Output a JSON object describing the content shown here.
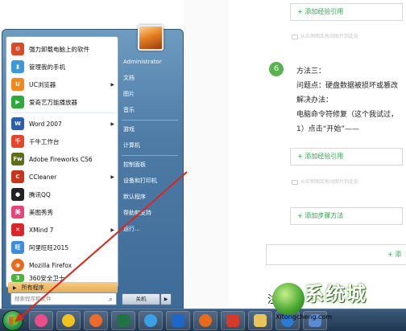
{
  "page": {
    "add_experience_ref": "+ 添加经验引用",
    "caption": "从右侧图库拖动图片到此处",
    "step_number": "6",
    "step_lines": [
      "方法三：",
      "问题点：硬盘数据被损坏或篡改",
      "解决办法：",
      "电脑命令符修复（这个我试过，",
      "1）点击“开始”——"
    ],
    "add_step_method": "+ 添加步骤方法",
    "add_fragment": "+ 添",
    "heading_fragment": "注"
  },
  "start_menu": {
    "pinned": [
      {
        "label": "强力卸载电脑上的软件",
        "icon": "uninstaller-icon",
        "color": "#d94a2a"
      },
      {
        "label": "管理我的手机",
        "icon": "phone-manager-icon",
        "color": "#3a9ad9"
      },
      {
        "label": "UC浏览器",
        "icon": "uc-browser-icon",
        "color": "#f08a1c",
        "arrow": "▶"
      },
      {
        "label": "爱奇艺万能播放器",
        "icon": "iqiyi-player-icon",
        "color": "#2dab3a"
      }
    ],
    "recent": [
      {
        "label": "Word 2007",
        "icon": "word-icon",
        "color": "#2b5fae",
        "arrow": "▶"
      },
      {
        "label": "千牛工作台",
        "icon": "qianniu-icon",
        "color": "#e4462b"
      },
      {
        "label": "Adobe Fireworks CS6",
        "icon": "fireworks-icon",
        "color": "#5c6e1a",
        "glyph": "Fw"
      },
      {
        "label": "CCleaner",
        "icon": "ccleaner-icon",
        "color": "#c9341c",
        "arrow": "▶"
      },
      {
        "label": "腾讯QQ",
        "icon": "qq-icon",
        "color": "#222222"
      },
      {
        "label": "美图秀秀",
        "icon": "meitu-icon",
        "color": "#e8437a"
      },
      {
        "label": "XMind 7",
        "icon": "xmind-icon",
        "color": "#d8262b",
        "arrow": "▶"
      },
      {
        "label": "阿里旺旺2015",
        "icon": "aliwangwang-icon",
        "color": "#3b8de0"
      },
      {
        "label": "Mozilla Firefox",
        "icon": "firefox-icon",
        "color": "#e86a1c"
      },
      {
        "label": "360安全卫士",
        "icon": "360-safe-icon",
        "color": "#4db33d"
      }
    ],
    "all_programs": "所有程序",
    "all_programs_arrow": "▶",
    "search_placeholder": "搜索程序和文件",
    "search_icon": "magnifier-icon",
    "right_items": [
      "Administrator",
      "文档",
      "图片",
      "音乐",
      "游戏",
      "计算机",
      "控制面板",
      "设备和打印机",
      "默认程序",
      "帮助和支持",
      "运行..."
    ],
    "shutdown": "关机",
    "shutdown_arrow": "▶"
  },
  "taskbar": {
    "apps": [
      {
        "name": "pinwheel-app-icon",
        "color": "#e94e8a"
      },
      {
        "name": "browser-app-icon",
        "color": "#f2c21e"
      },
      {
        "name": "colorful-app-icon",
        "color": "#ec6a2a"
      },
      {
        "name": "excel-app-icon",
        "color": "#217346"
      },
      {
        "name": "media-player-app-icon",
        "color": "#3aa1e6"
      },
      {
        "name": "infinity-app-icon",
        "color": "#1e66c8"
      },
      {
        "name": "firefox-app-icon",
        "color": "#e86a1c"
      },
      {
        "name": "red-app-icon",
        "color": "#d43a2a"
      },
      {
        "name": "folder-app-icon",
        "color": "#e9c45a"
      },
      {
        "name": "ie-app-icon",
        "color": "#2a7ad6"
      },
      {
        "name": "generic-app-icon",
        "color": "#5a8ad2"
      }
    ]
  },
  "watermark": {
    "brand": "系统城",
    "url": "Xitongcheng.com"
  }
}
